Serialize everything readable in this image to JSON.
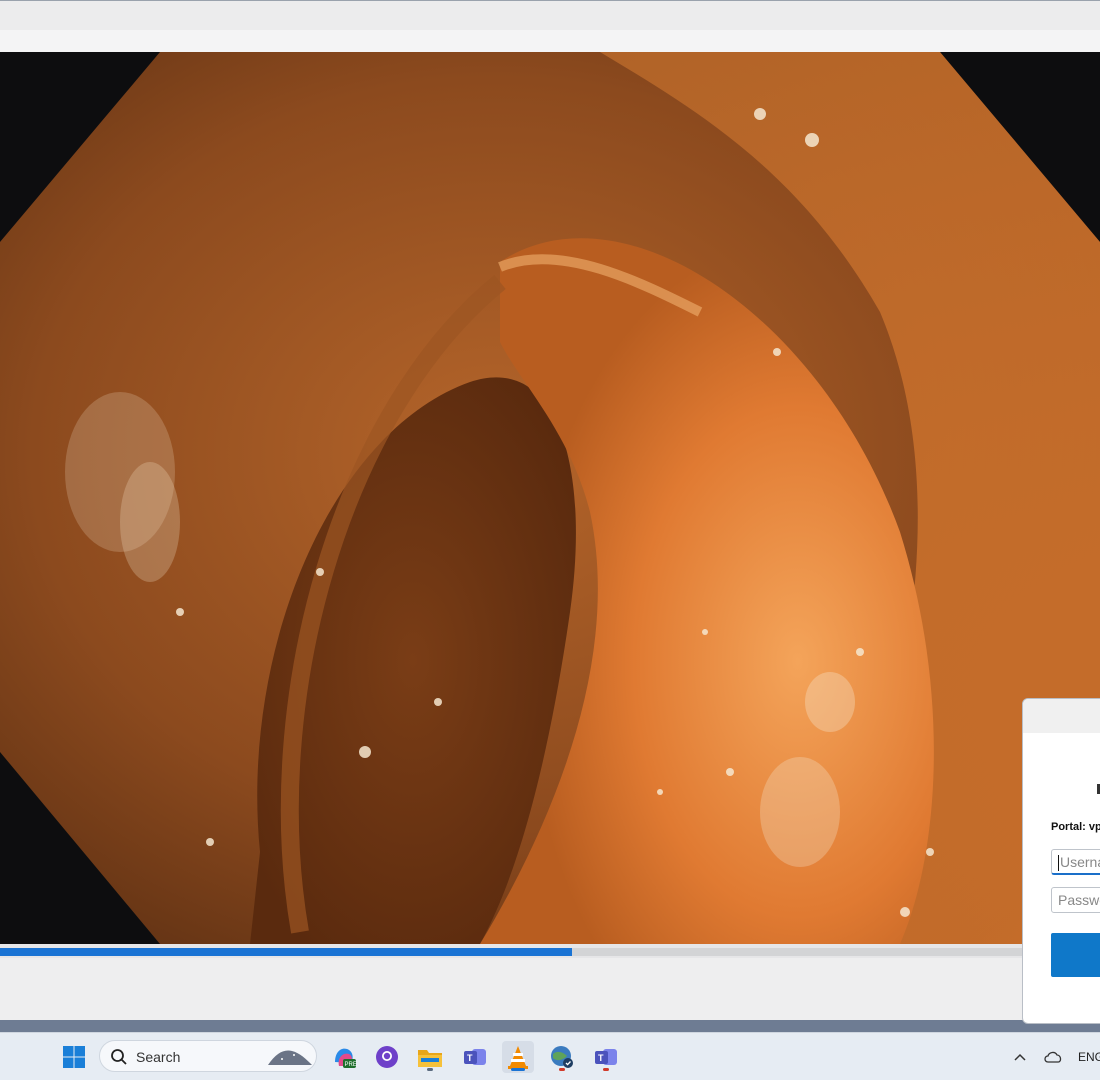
{
  "app": {
    "accent": "#1a73d4"
  },
  "video": {
    "progress_percent": 52
  },
  "dialog": {
    "portal_label": "Portal: vp",
    "username_placeholder": "Userna",
    "password_placeholder": "Passwo",
    "button_color": "#0f78c9"
  },
  "taskbar": {
    "start_icon": "windows-start-icon",
    "search_label": "Search",
    "apps": [
      {
        "name": "copilot-icon"
      },
      {
        "name": "github-icon"
      },
      {
        "name": "file-explorer-icon"
      },
      {
        "name": "teams-icon"
      },
      {
        "name": "vlc-icon"
      },
      {
        "name": "browser-icon"
      },
      {
        "name": "teams-work-icon"
      }
    ],
    "tray": {
      "language": "ENG",
      "chevron_icon": "chevron-up-icon",
      "cloud_icon": "onedrive-cloud-icon"
    }
  }
}
